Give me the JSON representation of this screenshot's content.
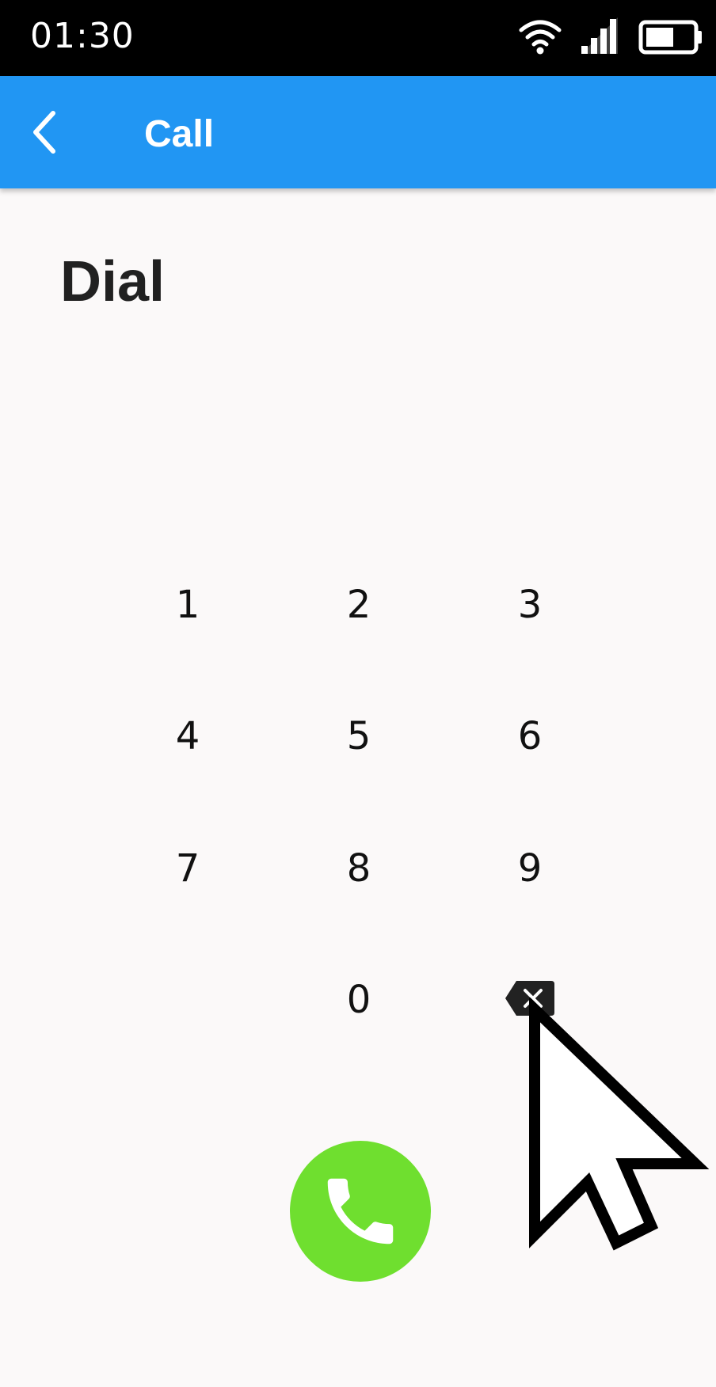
{
  "status_bar": {
    "time": "01:30",
    "icons": [
      "wifi-icon",
      "cellular-signal-icon",
      "battery-icon"
    ]
  },
  "app_bar": {
    "title": "Call",
    "back_icon": "chevron-left-icon",
    "background": "#2196f3"
  },
  "dial": {
    "heading": "Dial"
  },
  "keypad": {
    "keys": [
      "1",
      "2",
      "3",
      "4",
      "5",
      "6",
      "7",
      "8",
      "9",
      "0"
    ],
    "backspace_icon": "backspace-icon"
  },
  "call_button": {
    "icon": "phone-icon",
    "color": "#6fdf2f"
  }
}
